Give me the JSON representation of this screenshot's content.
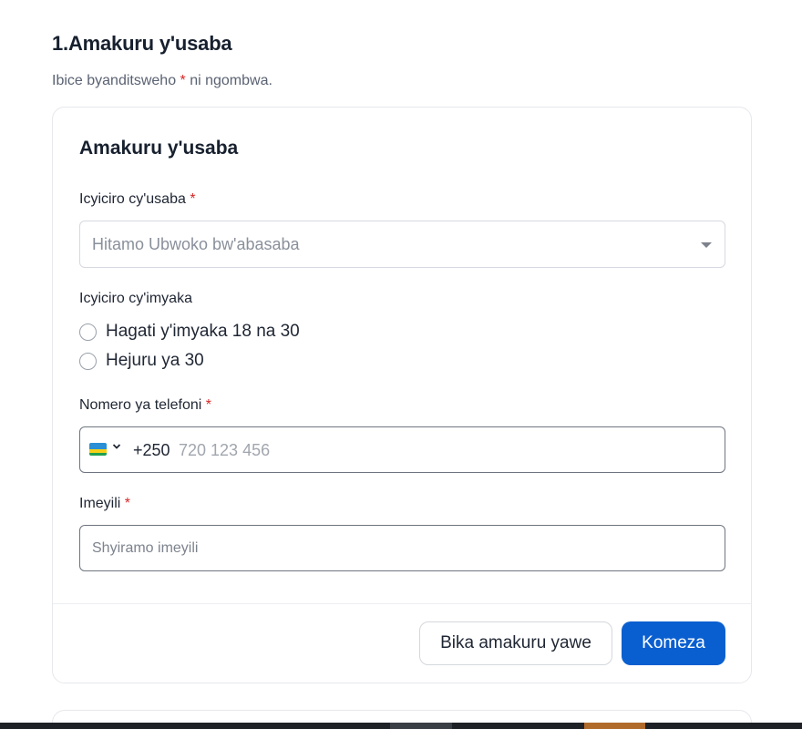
{
  "section": {
    "title": "1.Amakuru y'usaba",
    "subtitle_before": "Ibice byanditsweho ",
    "required_mark": "*",
    "subtitle_after": " ni ngombwa."
  },
  "card": {
    "title": "Amakuru y'usaba",
    "applicant_category": {
      "label": "Icyiciro cy'usaba",
      "required_mark": "*",
      "placeholder": "Hitamo Ubwoko bw'abasaba"
    },
    "age_category": {
      "label": "Icyiciro cy'imyaka",
      "options": [
        {
          "label": "Hagati y'imyaka 18 na 30"
        },
        {
          "label": "Hejuru ya 30"
        }
      ]
    },
    "phone": {
      "label": "Nomero ya telefoni",
      "required_mark": "*",
      "country_flag": "rwanda-flag-icon",
      "dial_code": "+250",
      "placeholder": "720 123 456"
    },
    "email": {
      "label": "Imeyili",
      "required_mark": "*",
      "placeholder": "Shyiramo imeyili"
    },
    "actions": {
      "save_label": "Bika amakuru yawe",
      "continue_label": "Komeza"
    }
  },
  "colors": {
    "primary": "#0a5fd0",
    "required": "#d62828",
    "text_dark": "#17202e",
    "muted": "#5a6272"
  }
}
